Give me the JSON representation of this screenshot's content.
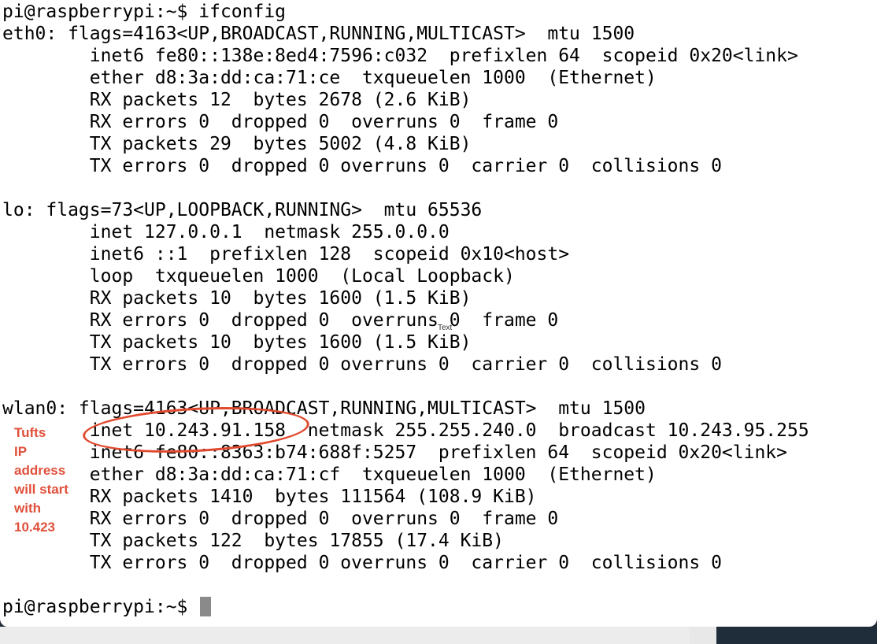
{
  "terminal": {
    "lines": [
      "pi@raspberrypi:~$ ifconfig",
      "eth0: flags=4163<UP,BROADCAST,RUNNING,MULTICAST>  mtu 1500",
      "        inet6 fe80::138e:8ed4:7596:c032  prefixlen 64  scopeid 0x20<link>",
      "        ether d8:3a:dd:ca:71:ce  txqueuelen 1000  (Ethernet)",
      "        RX packets 12  bytes 2678 (2.6 KiB)",
      "        RX errors 0  dropped 0  overruns 0  frame 0",
      "        TX packets 29  bytes 5002 (4.8 KiB)",
      "        TX errors 0  dropped 0 overruns 0  carrier 0  collisions 0",
      "",
      "lo: flags=73<UP,LOOPBACK,RUNNING>  mtu 65536",
      "        inet 127.0.0.1  netmask 255.0.0.0",
      "        inet6 ::1  prefixlen 128  scopeid 0x10<host>",
      "        loop  txqueuelen 1000  (Local Loopback)",
      "        RX packets 10  bytes 1600 (1.5 KiB)",
      "        RX errors 0  dropped 0  overruns 0  frame 0",
      "        TX packets 10  bytes 1600 (1.5 KiB)",
      "        TX errors 0  dropped 0 overruns 0  carrier 0  collisions 0",
      "",
      "wlan0: flags=4163<UP,BROADCAST,RUNNING,MULTICAST>  mtu 1500",
      "        inet 10.243.91.158  netmask 255.255.240.0  broadcast 10.243.95.255",
      "        inet6 fe80::8363:b74:688f:5257  prefixlen 64  scopeid 0x20<link>",
      "        ether d8:3a:dd:ca:71:cf  txqueuelen 1000  (Ethernet)",
      "        RX packets 1410  bytes 111564 (108.9 KiB)",
      "        RX errors 0  dropped 0  overruns 0  frame 0",
      "        TX packets 122  bytes 17855 (17.4 KiB)",
      "        TX errors 0  dropped 0 overruns 0  carrier 0  collisions 0",
      "",
      "pi@raspberrypi:~$ "
    ]
  },
  "annotation": {
    "text": "Tufts\nIP\naddress\nwill start\nwith\n10.423",
    "color": "#e0503a"
  },
  "text_tag": "Text",
  "colors": {
    "terminal_bg": "#ffffff",
    "text": "#000000",
    "highlight": "#e04a2f",
    "cursor": "#8a8a8a",
    "desktop": "#1f2c3a"
  }
}
